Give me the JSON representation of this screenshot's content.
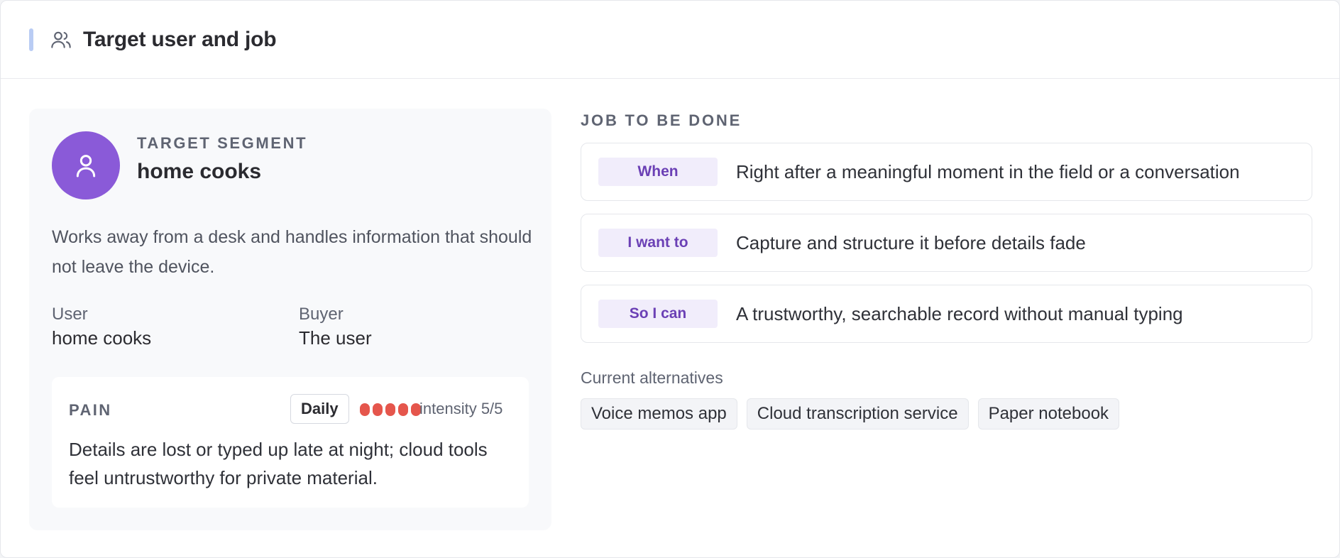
{
  "header": {
    "title": "Target user and job",
    "icon": "users-icon",
    "accent_color": "#b9ccf4"
  },
  "segment": {
    "label": "TARGET SEGMENT",
    "value": "home cooks",
    "avatar_icon": "user-icon",
    "avatar_color": "#8a5ad8",
    "description": "Works away from a desk and handles information that should not leave the device.",
    "user_label": "User",
    "user_value": "home cooks",
    "buyer_label": "Buyer",
    "buyer_value": "The user"
  },
  "pain": {
    "label": "PAIN",
    "frequency": "Daily",
    "intensity_value": 5,
    "intensity_max": 5,
    "intensity_text": "intensity 5/5",
    "dot_color": "#e5564c",
    "text": "Details are lost or typed up late at night; cloud tools feel untrustworthy for private material."
  },
  "jtbd": {
    "label": "JOB TO BE DONE",
    "rows": [
      {
        "tag": "When",
        "text": "Right after a meaningful moment in the field or a conversation"
      },
      {
        "tag": "I want to",
        "text": "Capture and structure it before details fade"
      },
      {
        "tag": "So I can",
        "text": "A trustworthy, searchable record without manual typing"
      }
    ]
  },
  "alternatives": {
    "label": "Current alternatives",
    "items": [
      "Voice memos app",
      "Cloud transcription service",
      "Paper notebook"
    ]
  }
}
